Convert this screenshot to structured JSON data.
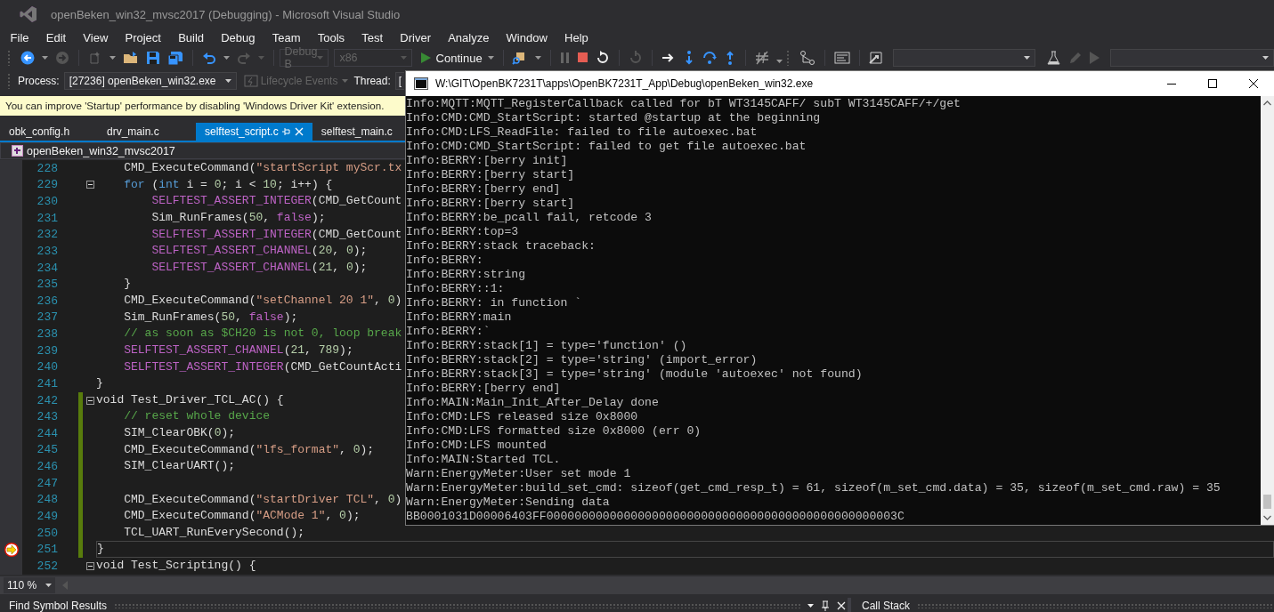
{
  "window": {
    "title": "openBeken_win32_mvsc2017 (Debugging) - Microsoft Visual Studio"
  },
  "menu": [
    "File",
    "Edit",
    "View",
    "Project",
    "Build",
    "Debug",
    "Team",
    "Tools",
    "Test",
    "Driver",
    "Analyze",
    "Window",
    "Help"
  ],
  "toolbar": {
    "configuration": {
      "value": "Debug B",
      "disabled": true
    },
    "platform": {
      "value": "x86",
      "disabled": true
    },
    "continue_button": "Continue"
  },
  "debug_location": {
    "process_label": "Process:",
    "process": "[27236] openBeken_win32.exe",
    "lifecycle_events": {
      "label": "Lifecycle Events",
      "disabled": true
    },
    "thread_label": "Thread:",
    "thread": "["
  },
  "info_bar": "You can improve 'Startup' performance by disabling 'Windows Driver Kit' extension.",
  "tabs": [
    {
      "label": "obk_config.h",
      "selected": false
    },
    {
      "label": "drv_main.c",
      "selected": false
    },
    {
      "label": "selftest_script.c",
      "selected": true
    },
    {
      "label": "selftest_main.c",
      "selected": false
    }
  ],
  "navigation": {
    "project": "openBeken_win32_mvsc2017"
  },
  "code_lines": [
    {
      "number": "228",
      "changed": false,
      "foldable": false,
      "current": false,
      "tokens": [
        {
          "kind": "plain",
          "text": "    CMD_ExecuteCommand("
        },
        {
          "kind": "string",
          "text": "\"startScript myScr.tx"
        }
      ]
    },
    {
      "number": "229",
      "changed": false,
      "foldable": true,
      "current": false,
      "tokens": [
        {
          "kind": "keyword",
          "text": "    for"
        },
        {
          "kind": "plain",
          "text": " ("
        },
        {
          "kind": "keyword",
          "text": "int"
        },
        {
          "kind": "plain",
          "text": " i = "
        },
        {
          "kind": "number",
          "text": "0"
        },
        {
          "kind": "plain",
          "text": "; i < "
        },
        {
          "kind": "number",
          "text": "10"
        },
        {
          "kind": "plain",
          "text": "; i++) {"
        }
      ]
    },
    {
      "number": "230",
      "changed": false,
      "foldable": false,
      "current": false,
      "tokens": [
        {
          "kind": "macro",
          "text": "        SELFTEST_ASSERT_INTEGER"
        },
        {
          "kind": "plain",
          "text": "(CMD_GetCount"
        }
      ]
    },
    {
      "number": "231",
      "changed": false,
      "foldable": false,
      "current": false,
      "tokens": [
        {
          "kind": "plain",
          "text": "        Sim_RunFrames("
        },
        {
          "kind": "number",
          "text": "50"
        },
        {
          "kind": "plain",
          "text": ", "
        },
        {
          "kind": "literal",
          "text": "false"
        },
        {
          "kind": "plain",
          "text": ");"
        }
      ]
    },
    {
      "number": "232",
      "changed": false,
      "foldable": false,
      "current": false,
      "tokens": [
        {
          "kind": "macro",
          "text": "        SELFTEST_ASSERT_INTEGER"
        },
        {
          "kind": "plain",
          "text": "(CMD_GetCount"
        }
      ]
    },
    {
      "number": "233",
      "changed": false,
      "foldable": false,
      "current": false,
      "tokens": [
        {
          "kind": "macro",
          "text": "        SELFTEST_ASSERT_CHANNEL"
        },
        {
          "kind": "plain",
          "text": "("
        },
        {
          "kind": "number",
          "text": "20"
        },
        {
          "kind": "plain",
          "text": ", "
        },
        {
          "kind": "number",
          "text": "0"
        },
        {
          "kind": "plain",
          "text": ");"
        }
      ]
    },
    {
      "number": "234",
      "changed": false,
      "foldable": false,
      "current": false,
      "tokens": [
        {
          "kind": "macro",
          "text": "        SELFTEST_ASSERT_CHANNEL"
        },
        {
          "kind": "plain",
          "text": "("
        },
        {
          "kind": "number",
          "text": "21"
        },
        {
          "kind": "plain",
          "text": ", "
        },
        {
          "kind": "number",
          "text": "0"
        },
        {
          "kind": "plain",
          "text": ");"
        }
      ]
    },
    {
      "number": "235",
      "changed": false,
      "foldable": false,
      "current": false,
      "tokens": [
        {
          "kind": "plain",
          "text": "    }"
        }
      ]
    },
    {
      "number": "236",
      "changed": false,
      "foldable": false,
      "current": false,
      "tokens": [
        {
          "kind": "plain",
          "text": "    CMD_ExecuteCommand("
        },
        {
          "kind": "string",
          "text": "\"setChannel 20 1\""
        },
        {
          "kind": "plain",
          "text": ", "
        },
        {
          "kind": "number",
          "text": "0"
        },
        {
          "kind": "plain",
          "text": ")"
        }
      ]
    },
    {
      "number": "237",
      "changed": false,
      "foldable": false,
      "current": false,
      "tokens": [
        {
          "kind": "plain",
          "text": "    Sim_RunFrames("
        },
        {
          "kind": "number",
          "text": "50"
        },
        {
          "kind": "plain",
          "text": ", "
        },
        {
          "kind": "literal",
          "text": "false"
        },
        {
          "kind": "plain",
          "text": ");"
        }
      ]
    },
    {
      "number": "238",
      "changed": false,
      "foldable": false,
      "current": false,
      "tokens": [
        {
          "kind": "comment",
          "text": "    // as soon as $CH20 is not 0, loop break"
        }
      ]
    },
    {
      "number": "239",
      "changed": false,
      "foldable": false,
      "current": false,
      "tokens": [
        {
          "kind": "macro",
          "text": "    SELFTEST_ASSERT_CHANNEL"
        },
        {
          "kind": "plain",
          "text": "("
        },
        {
          "kind": "number",
          "text": "21"
        },
        {
          "kind": "plain",
          "text": ", "
        },
        {
          "kind": "number",
          "text": "789"
        },
        {
          "kind": "plain",
          "text": ");"
        }
      ]
    },
    {
      "number": "240",
      "changed": false,
      "foldable": false,
      "current": false,
      "tokens": [
        {
          "kind": "macro",
          "text": "    SELFTEST_ASSERT_INTEGER"
        },
        {
          "kind": "plain",
          "text": "(CMD_GetCountActi"
        }
      ]
    },
    {
      "number": "241",
      "changed": false,
      "foldable": false,
      "current": false,
      "tokens": [
        {
          "kind": "plain",
          "text": "}"
        }
      ]
    },
    {
      "number": "242",
      "changed": true,
      "foldable": true,
      "current": false,
      "tokens": [
        {
          "kind": "plain",
          "text": "void Test_Driver_TCL_AC() {"
        }
      ]
    },
    {
      "number": "243",
      "changed": true,
      "foldable": false,
      "current": false,
      "tokens": [
        {
          "kind": "comment",
          "text": "    // reset whole device"
        }
      ]
    },
    {
      "number": "244",
      "changed": true,
      "foldable": false,
      "current": false,
      "tokens": [
        {
          "kind": "plain",
          "text": "    SIM_ClearOBK("
        },
        {
          "kind": "number",
          "text": "0"
        },
        {
          "kind": "plain",
          "text": ");"
        }
      ]
    },
    {
      "number": "245",
      "changed": true,
      "foldable": false,
      "current": false,
      "tokens": [
        {
          "kind": "plain",
          "text": "    CMD_ExecuteCommand("
        },
        {
          "kind": "string",
          "text": "\"lfs_format\""
        },
        {
          "kind": "plain",
          "text": ", "
        },
        {
          "kind": "number",
          "text": "0"
        },
        {
          "kind": "plain",
          "text": ");"
        }
      ]
    },
    {
      "number": "246",
      "changed": true,
      "foldable": false,
      "current": false,
      "tokens": [
        {
          "kind": "plain",
          "text": "    SIM_ClearUART();"
        }
      ]
    },
    {
      "number": "247",
      "changed": true,
      "foldable": false,
      "current": false
    },
    {
      "number": "248",
      "changed": true,
      "foldable": false,
      "current": false,
      "tokens": [
        {
          "kind": "plain",
          "text": "    CMD_ExecuteCommand("
        },
        {
          "kind": "string",
          "text": "\"startDriver TCL\""
        },
        {
          "kind": "plain",
          "text": ", "
        },
        {
          "kind": "number",
          "text": "0"
        },
        {
          "kind": "plain",
          "text": ")"
        }
      ]
    },
    {
      "number": "249",
      "changed": true,
      "foldable": false,
      "current": false,
      "tokens": [
        {
          "kind": "plain",
          "text": "    CMD_ExecuteCommand("
        },
        {
          "kind": "string",
          "text": "\"ACMode 1\""
        },
        {
          "kind": "plain",
          "text": ", "
        },
        {
          "kind": "number",
          "text": "0"
        },
        {
          "kind": "plain",
          "text": ");"
        }
      ]
    },
    {
      "number": "250",
      "changed": true,
      "foldable": false,
      "current": false,
      "tokens": [
        {
          "kind": "plain",
          "text": "    TCL_UART_RunEverySecond();"
        }
      ]
    },
    {
      "number": "251",
      "changed": true,
      "foldable": false,
      "current": true,
      "tokens": [
        {
          "kind": "plain",
          "text": "}"
        }
      ]
    },
    {
      "number": "252",
      "changed": false,
      "foldable": true,
      "current": false,
      "tokens": [
        {
          "kind": "plain",
          "text": "void Test_Scripting() {"
        }
      ]
    }
  ],
  "zoom": "110 %",
  "panels": [
    {
      "title": "Find Symbol Results"
    },
    {
      "title": "Call Stack"
    }
  ],
  "console": {
    "title": "W:\\GIT\\OpenBK7231T\\apps\\OpenBK7231T_App\\Debug\\openBeken_win32.exe",
    "lines": [
      "Info:MQTT:MQTT_RegisterCallback called for bT WT3145CAFF/ subT WT3145CAFF/+/get",
      "Info:CMD:CMD_StartScript: started @startup at the beginning",
      "Info:CMD:LFS_ReadFile: failed to file autoexec.bat",
      "Info:CMD:CMD_StartScript: failed to get file autoexec.bat",
      "Info:BERRY:[berry init]",
      "Info:BERRY:[berry start]",
      "Info:BERRY:[berry end]",
      "Info:BERRY:[berry start]",
      "Info:BERRY:be_pcall fail, retcode 3",
      "Info:BERRY:top=3",
      "Info:BERRY:stack traceback:",
      "Info:BERRY:",
      "Info:BERRY:string",
      "Info:BERRY::1:",
      "Info:BERRY: in function `",
      "Info:BERRY:main",
      "Info:BERRY:`",
      "Info:BERRY:stack[1] = type='function' ()",
      "Info:BERRY:stack[2] = type='string' (import_error)",
      "Info:BERRY:stack[3] = type='string' (module 'autoexec' not found)",
      "Info:BERRY:[berry end]",
      "Info:MAIN:Main_Init_After_Delay done",
      "Info:CMD:LFS released size 0x8000",
      "Info:CMD:LFS formatted size 0x8000 (err 0)",
      "Info:CMD:LFS mounted",
      "Info:MAIN:Started TCL.",
      "Warn:EnergyMeter:User set mode 1",
      "Warn:EnergyMeter:build_set_cmd: sizeof(get_cmd_resp_t) = 61, sizeof(m_set_cmd.data) = 35, sizeof(m_set_cmd.raw) = 35",
      "Warn:EnergyMeter:Sending data",
      "BB0001031D00006403FF00000000000000000000000000000000000000000000000003C"
    ]
  }
}
